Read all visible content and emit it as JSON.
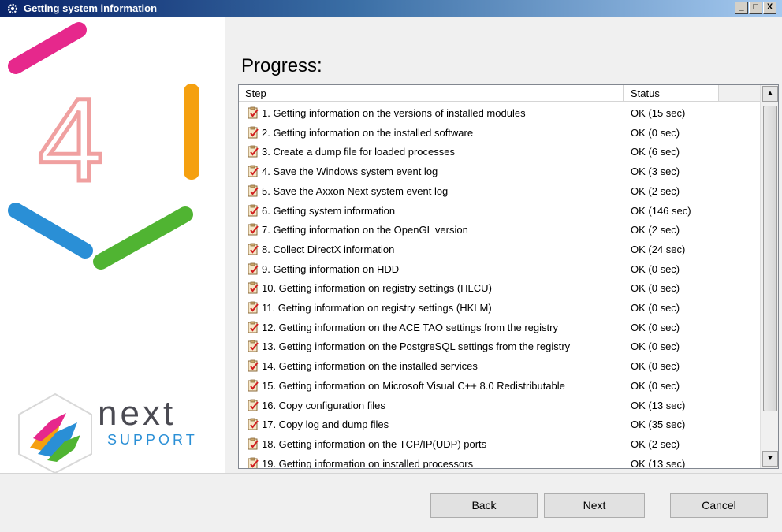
{
  "window": {
    "title": "Getting system information",
    "controls": [
      "_",
      "□",
      "X"
    ]
  },
  "branding": {
    "version_digit": "4",
    "product": "next",
    "support": "SUPPORT"
  },
  "heading": "Progress:",
  "table": {
    "columns": [
      "Step",
      "Status"
    ],
    "rows": [
      {
        "step": "1. Getting information on the versions of installed modules",
        "status": "OK (15 sec)"
      },
      {
        "step": "2. Getting information on the installed software",
        "status": "OK (0 sec)"
      },
      {
        "step": "3. Create a dump file for loaded processes",
        "status": "OK (6 sec)"
      },
      {
        "step": "4. Save the Windows system event log",
        "status": "OK (3 sec)"
      },
      {
        "step": "5. Save the Axxon Next system event log",
        "status": "OK (2 sec)"
      },
      {
        "step": "6. Getting system information",
        "status": "OK (146 sec)"
      },
      {
        "step": "7. Getting information on the OpenGL version",
        "status": "OK (2 sec)"
      },
      {
        "step": "8. Collect DirectX information",
        "status": "OK (24 sec)"
      },
      {
        "step": "9. Getting information on HDD",
        "status": "OK (0 sec)"
      },
      {
        "step": "10. Getting information on registry settings (HLCU)",
        "status": "OK (0 sec)"
      },
      {
        "step": "11. Getting information on registry settings (HKLM)",
        "status": "OK (0 sec)"
      },
      {
        "step": "12. Getting information on the ACE TAO settings from the registry",
        "status": "OK (0 sec)"
      },
      {
        "step": "13. Getting information on the PostgreSQL settings from the registry",
        "status": "OK (0 sec)"
      },
      {
        "step": "14. Getting information on the installed services",
        "status": "OK (0 sec)"
      },
      {
        "step": "15. Getting information on Microsoft Visual C++ 8.0 Redistributable",
        "status": "OK (0 sec)"
      },
      {
        "step": "16. Copy configuration files",
        "status": "OK (13 sec)"
      },
      {
        "step": "17. Copy log and dump files",
        "status": "OK (35 sec)"
      },
      {
        "step": "18. Getting  information on the TCP/IP(UDP) ports",
        "status": "OK (2 sec)"
      },
      {
        "step": "19. Getting information on installed processors",
        "status": "OK (13 sec)"
      }
    ]
  },
  "buttons": {
    "back": "Back",
    "next": "Next",
    "cancel": "Cancel"
  },
  "icons": {
    "row": "clipboard-check-icon",
    "title": "gear-icon"
  },
  "colors": {
    "hex_magenta": "#e6288c",
    "hex_orange": "#f5a00f",
    "hex_green": "#50b432",
    "hex_blue": "#2a8fd6",
    "digit": "#f0a0a0"
  }
}
